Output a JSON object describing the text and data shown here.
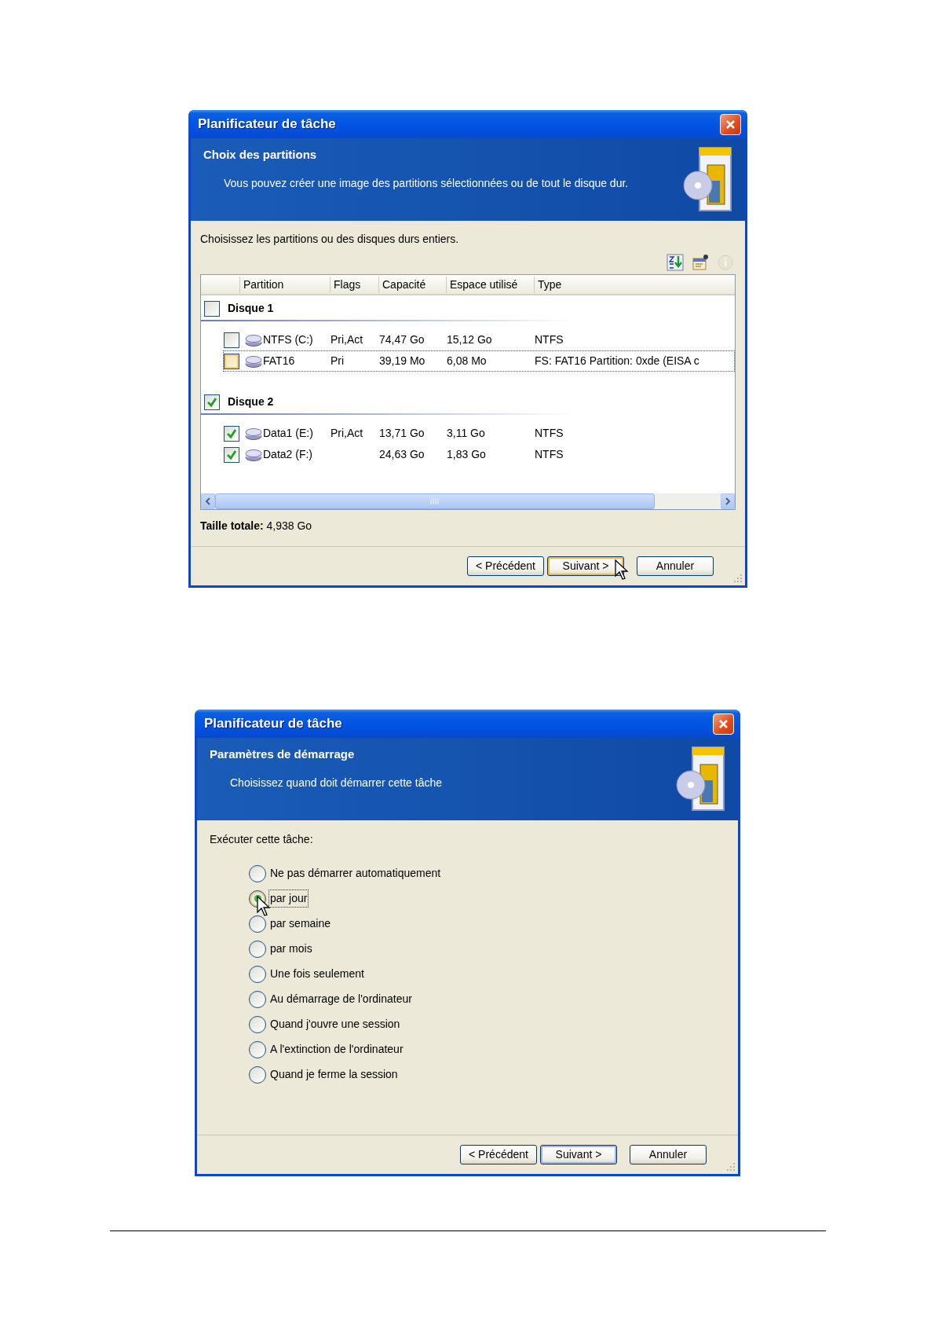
{
  "dialogs": [
    {
      "kind": "partitions",
      "title": "Planificateur de tâche",
      "heading": "Choix des partitions",
      "subtitle": "Vous pouvez créer une image des partitions sélectionnées ou de tout le disque dur.",
      "instruction": "Choisissez les partitions ou des disques durs entiers.",
      "toolbar": [
        {
          "kind": "sort",
          "disabled": false
        },
        {
          "kind": "properties",
          "disabled": false
        },
        {
          "kind": "info",
          "disabled": true
        }
      ],
      "table": {
        "columns": [
          "Partition",
          "Flags",
          "Capacité",
          "Espace utilisé",
          "Type"
        ],
        "groups": [
          {
            "label": "Disque 1",
            "checked": false,
            "rows": [
              {
                "cells": [
                  "NTFS (C:)",
                  "Pri,Act",
                  "74,47 Go",
                  "15,12 Go",
                  "NTFS"
                ],
                "checked": false,
                "focused": false
              },
              {
                "cells": [
                  "FAT16",
                  "Pri",
                  "39,19 Mo",
                  "6,08 Mo",
                  "FS: FAT16 Partition: 0xde (EISA c"
                ],
                "checked": false,
                "focused": true
              }
            ]
          },
          {
            "label": "Disque 2",
            "checked": true,
            "rows": [
              {
                "cells": [
                  "Data1 (E:)",
                  "Pri,Act",
                  "13,71 Go",
                  "3,11 Go",
                  "NTFS"
                ],
                "checked": true,
                "focused": false
              },
              {
                "cells": [
                  "Data2 (F:)",
                  "",
                  "24,63 Go",
                  "1,83 Go",
                  "NTFS"
                ],
                "checked": true,
                "focused": false
              }
            ]
          }
        ]
      },
      "total": "**Taille totale:** 4,938 Go",
      "buttons": [
        {
          "label": "< Précédent",
          "default": false,
          "hovered": false
        },
        {
          "label": "Suivant >",
          "default": true,
          "hovered": true
        },
        {
          "label": "Annuler",
          "default": false,
          "hovered": false
        }
      ]
    },
    {
      "kind": "startup",
      "title": "Planificateur de tâche",
      "heading": "Paramètres de démarrage",
      "subtitle": "Choisissez quand doit démarrer cette tâche",
      "prompt": "Exécuter cette tâche:",
      "options": [
        {
          "label": "Ne pas démarrer automatiquement",
          "selected": false,
          "focused": false,
          "hovered": false
        },
        {
          "label": "par jour",
          "selected": true,
          "focused": true,
          "hovered": true
        },
        {
          "label": "par semaine",
          "selected": false,
          "focused": false,
          "hovered": false
        },
        {
          "label": "par mois",
          "selected": false,
          "focused": false,
          "hovered": false
        },
        {
          "label": "Une fois seulement",
          "selected": false,
          "focused": false,
          "hovered": false
        },
        {
          "label": "Au démarrage de l'ordinateur",
          "selected": false,
          "focused": false,
          "hovered": false
        },
        {
          "label": "Quand j'ouvre une session",
          "selected": false,
          "focused": false,
          "hovered": false
        },
        {
          "label": "A l'extinction de l'ordinateur",
          "selected": false,
          "focused": false,
          "hovered": false
        },
        {
          "label": "Quand je ferme la session",
          "selected": false,
          "focused": false,
          "hovered": false
        }
      ],
      "buttons": [
        {
          "label": "< Précédent",
          "default": false,
          "hovered": false
        },
        {
          "label": "Suivant >",
          "default": true,
          "hovered": false
        },
        {
          "label": "Annuler",
          "default": false,
          "hovered": false
        }
      ]
    }
  ]
}
